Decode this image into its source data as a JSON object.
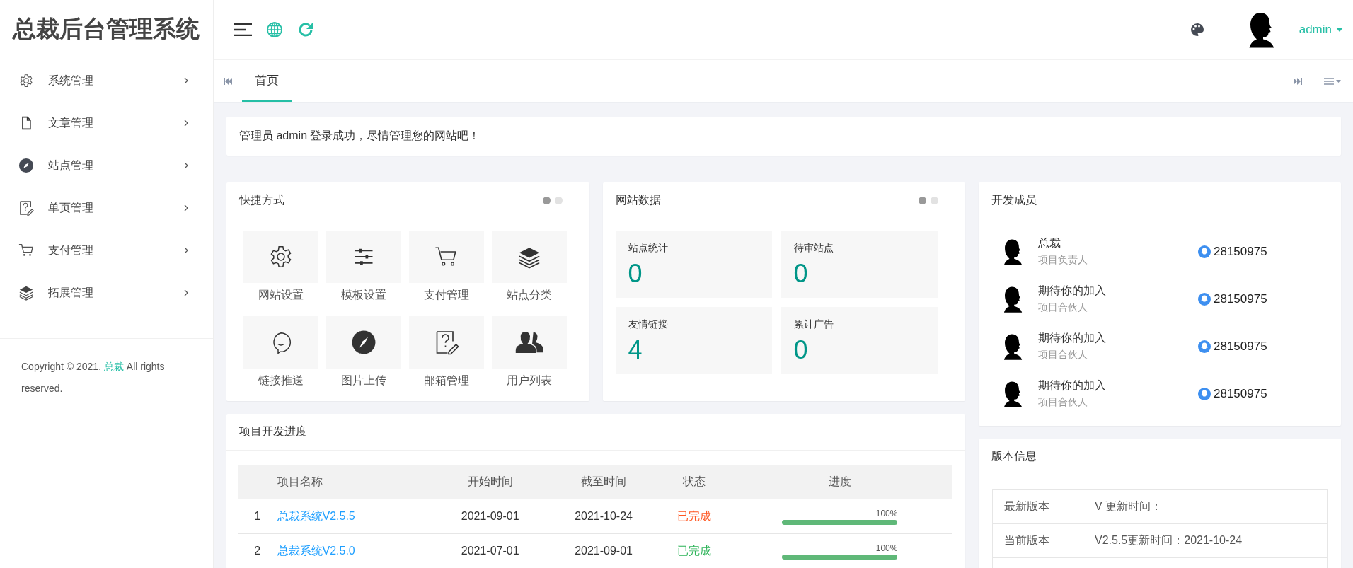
{
  "logo": "总裁后台管理系统",
  "header": {
    "user": "admin"
  },
  "sidebar": {
    "items": [
      {
        "label": "系统管理"
      },
      {
        "label": "文章管理"
      },
      {
        "label": "站点管理"
      },
      {
        "label": "单页管理"
      },
      {
        "label": "支付管理"
      },
      {
        "label": "拓展管理"
      }
    ],
    "footer": {
      "before": "Copyright © 2021.",
      "link": "总裁",
      "after": "All rights reserved."
    }
  },
  "tabs": [
    {
      "label": "首页",
      "selected": true
    }
  ],
  "notice": "管理员 admin 登录成功，尽情管理您的网站吧！",
  "shortcuts": {
    "title": "快捷方式",
    "indicators": [
      {
        "selected": true
      },
      {
        "selected": false
      }
    ],
    "items": [
      {
        "label": "网站设置"
      },
      {
        "label": "模板设置"
      },
      {
        "label": "支付管理"
      },
      {
        "label": "站点分类"
      },
      {
        "label": "链接推送"
      },
      {
        "label": "图片上传"
      },
      {
        "label": "邮箱管理"
      },
      {
        "label": "用户列表"
      }
    ]
  },
  "site_data": {
    "title": "网站数据",
    "indicators": [
      {
        "selected": true
      },
      {
        "selected": false
      }
    ],
    "items": [
      {
        "label": "站点统计",
        "value": "0"
      },
      {
        "label": "待审站点",
        "value": "0"
      },
      {
        "label": "友情链接",
        "value": "4"
      },
      {
        "label": "累计广告",
        "value": "0"
      }
    ]
  },
  "members": {
    "title": "开发成员",
    "items": [
      {
        "name": "总裁",
        "role": "项目负责人",
        "qq": "28150975"
      },
      {
        "name": "期待你的加入",
        "role": "项目合伙人",
        "qq": "28150975"
      },
      {
        "name": "期待你的加入",
        "role": "项目合伙人",
        "qq": "28150975"
      },
      {
        "name": "期待你的加入",
        "role": "项目合伙人",
        "qq": "28150975"
      }
    ]
  },
  "progress": {
    "title": "项目开发进度",
    "columns": [
      "项目名称",
      "开始时间",
      "截至时间",
      "状态",
      "进度"
    ],
    "rows": [
      {
        "index": "1",
        "name": "总裁系统V2.5.5",
        "start": "2021-09-01",
        "end": "2021-10-24",
        "status": "已完成",
        "color": "#ff5722",
        "level": 1,
        "percent": "100%"
      },
      {
        "index": "2",
        "name": "总裁系统V2.5.0",
        "start": "2021-07-01",
        "end": "2021-09-01",
        "status": "已完成",
        "color": "#2fb45a",
        "level": 1,
        "percent": "100%"
      }
    ]
  },
  "version": {
    "title": "版本信息",
    "rows": [
      {
        "label": "最新版本",
        "value": "V 更新时间："
      },
      {
        "label": "当前版本",
        "value": "V2.5.5更新时间：2021-10-24"
      }
    ]
  }
}
